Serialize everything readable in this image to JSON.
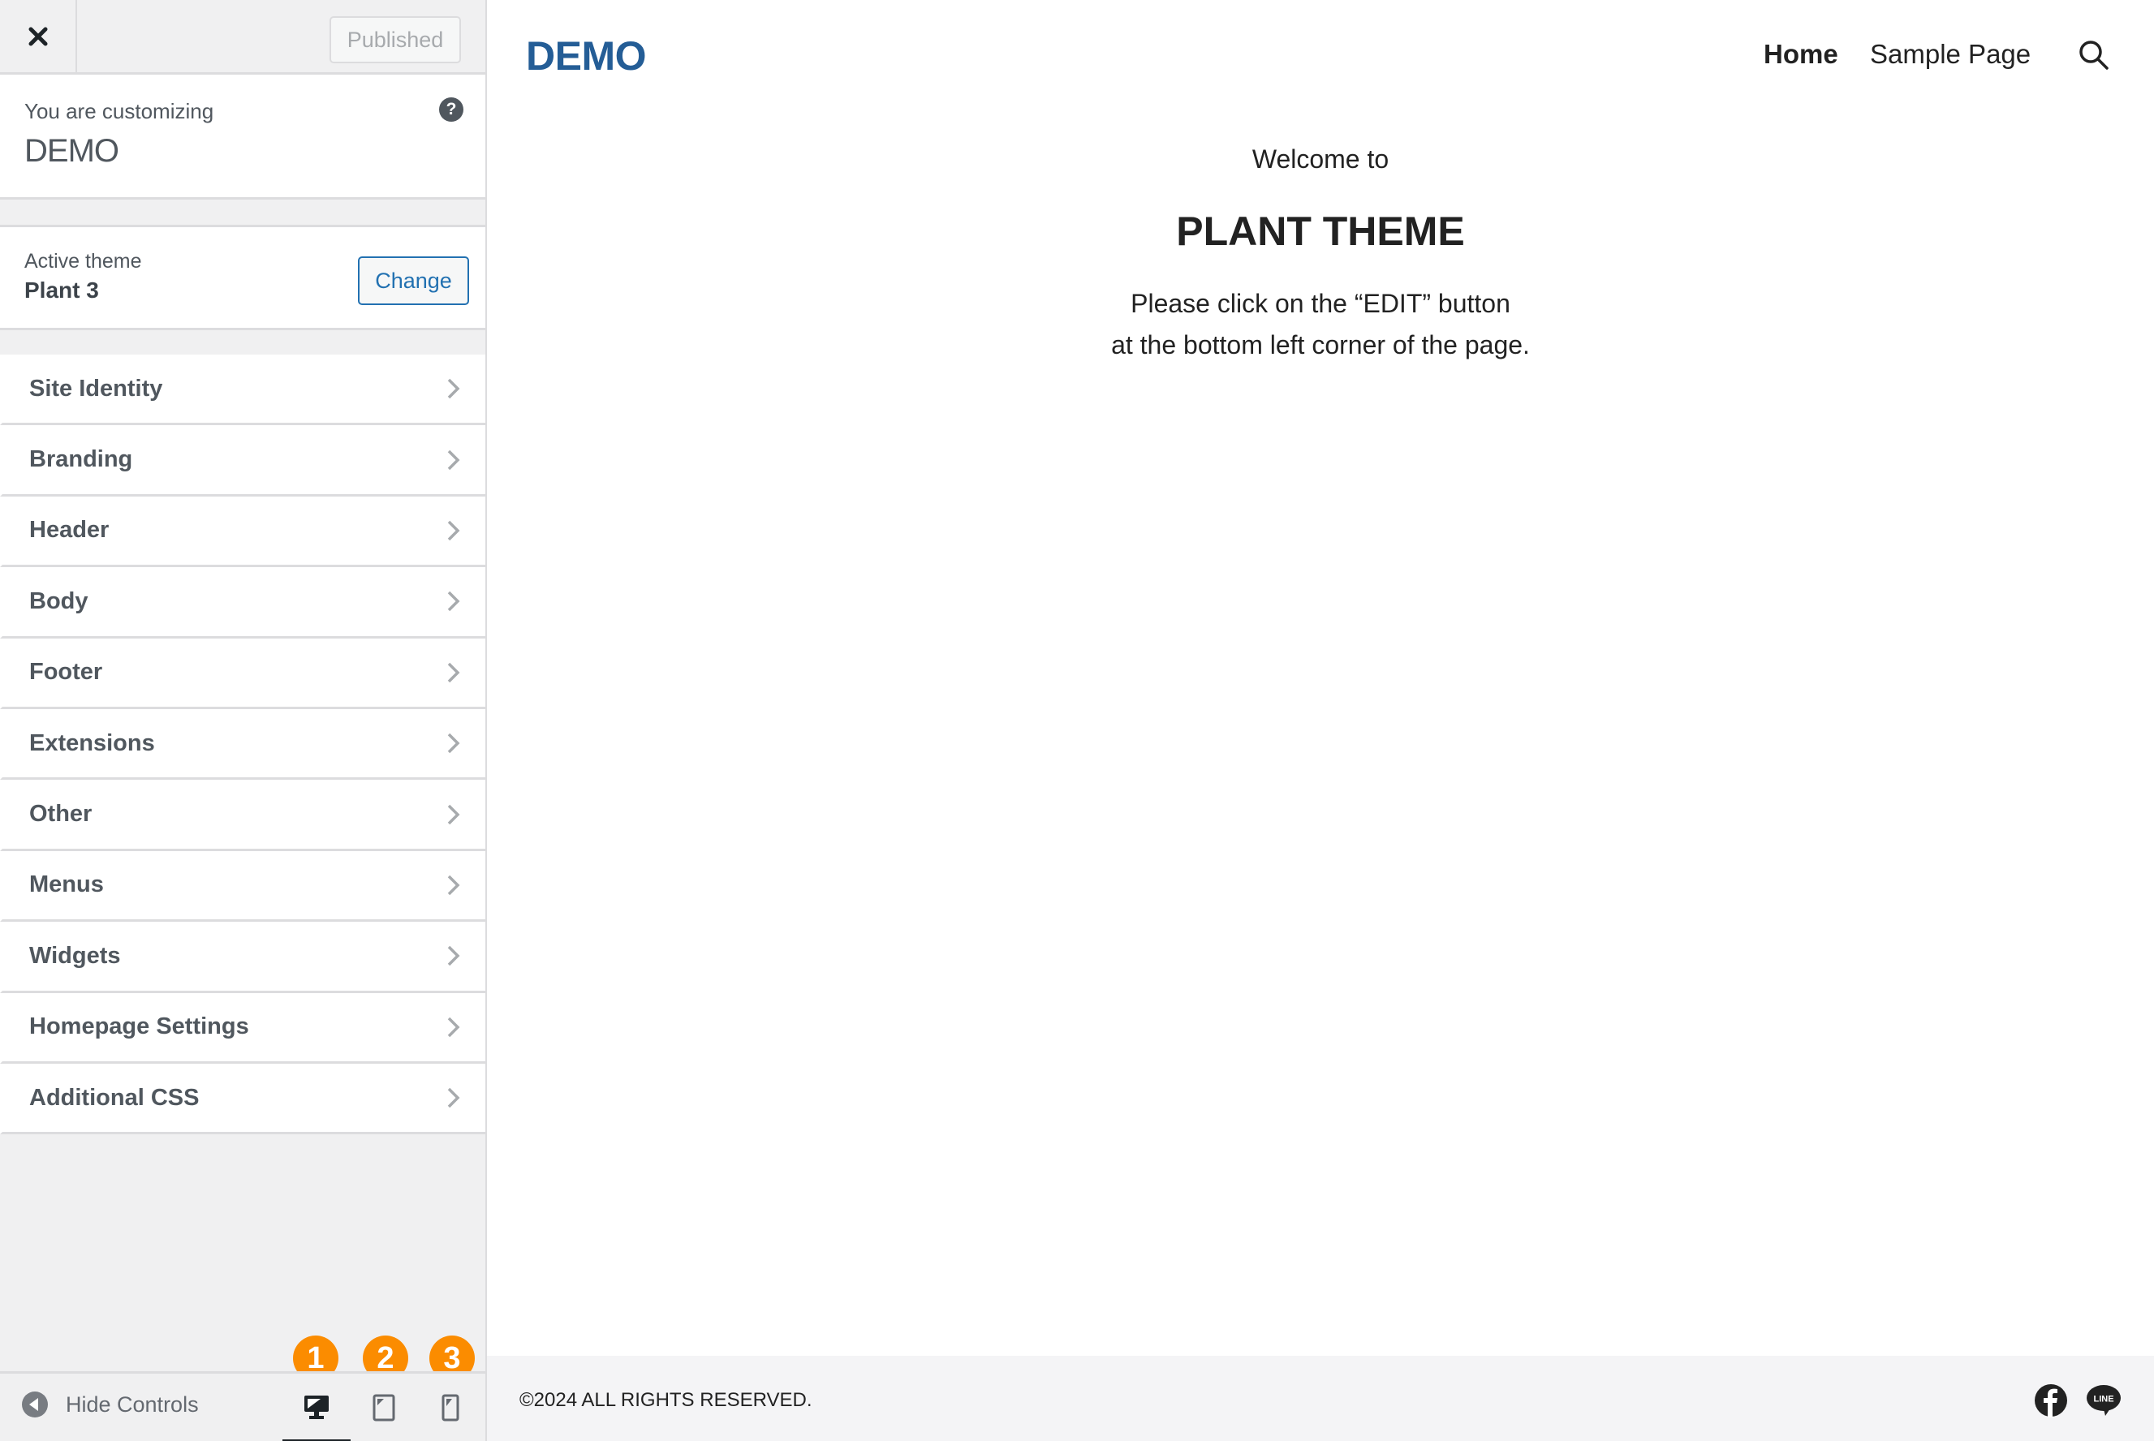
{
  "sidebar": {
    "publish_label": "Published",
    "customizing_label": "You are customizing",
    "site_name": "DEMO",
    "help_icon": "?",
    "active_theme_label": "Active theme",
    "active_theme_name": "Plant 3",
    "change_label": "Change",
    "menu_items": [
      {
        "label": "Site Identity"
      },
      {
        "label": "Branding"
      },
      {
        "label": "Header"
      },
      {
        "label": "Body"
      },
      {
        "label": "Footer"
      },
      {
        "label": "Extensions"
      },
      {
        "label": "Other"
      },
      {
        "label": "Menus"
      },
      {
        "label": "Widgets"
      },
      {
        "label": "Homepage Settings"
      },
      {
        "label": "Additional CSS"
      }
    ],
    "hide_controls_label": "Hide Controls",
    "devices": [
      {
        "name": "desktop",
        "badge": "1",
        "active": true
      },
      {
        "name": "tablet",
        "badge": "2",
        "active": false
      },
      {
        "name": "mobile",
        "badge": "3",
        "active": false
      }
    ]
  },
  "preview": {
    "logo": "DEMO",
    "nav": [
      {
        "label": "Home",
        "current": true
      },
      {
        "label": "Sample Page",
        "current": false
      }
    ],
    "welcome": "Welcome to",
    "title": "PLANT THEME",
    "line1": "Please click on the “EDIT” button",
    "line2": "at the bottom left corner of the page.",
    "copyright": "©2024 ALL RIGHTS RESERVED.",
    "social": [
      "facebook",
      "line"
    ],
    "line_icon_text": "LINE"
  },
  "colors": {
    "accent": "#2271b1",
    "logo": "#245d96",
    "badge": "#fb8c00",
    "sidebar_bg": "#f0f0f1"
  }
}
